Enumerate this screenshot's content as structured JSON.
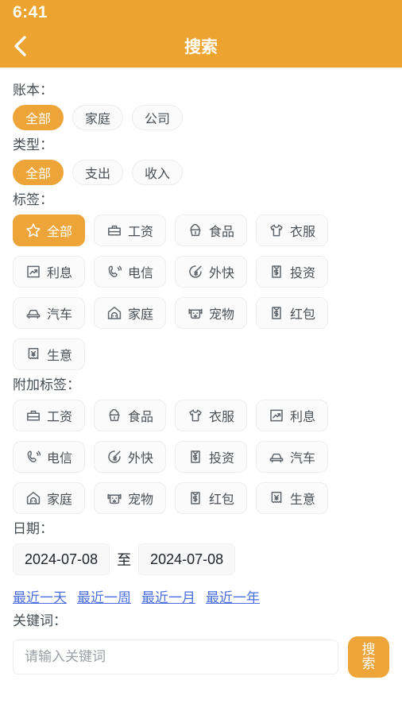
{
  "status": {
    "time": "6:41"
  },
  "header": {
    "title": "搜索",
    "back_icon": "chevron-left-icon",
    "bg": "#eda32f"
  },
  "theme": {
    "accent": "#eda53a",
    "link": "#4b6fe0"
  },
  "sections": {
    "account_book": {
      "label": "账本：",
      "options": [
        {
          "label": "全部",
          "active": true
        },
        {
          "label": "家庭",
          "active": false
        },
        {
          "label": "公司",
          "active": false
        }
      ]
    },
    "type": {
      "label": "类型：",
      "options": [
        {
          "label": "全部",
          "active": true
        },
        {
          "label": "支出",
          "active": false
        },
        {
          "label": "收入",
          "active": false
        }
      ]
    },
    "tags": {
      "label": "标签：",
      "items": [
        {
          "label": "全部",
          "icon": "star-icon",
          "active": true
        },
        {
          "label": "工资",
          "icon": "briefcase-icon",
          "active": false
        },
        {
          "label": "食品",
          "icon": "cupcake-icon",
          "active": false
        },
        {
          "label": "衣服",
          "icon": "tshirt-icon",
          "active": false
        },
        {
          "label": "利息",
          "icon": "trend-up-icon",
          "active": false
        },
        {
          "label": "电信",
          "icon": "phone-signal-icon",
          "active": false
        },
        {
          "label": "外快",
          "icon": "clock-yuan-icon",
          "active": false
        },
        {
          "label": "投资",
          "icon": "money-envelope-icon",
          "active": false
        },
        {
          "label": "汽车",
          "icon": "car-icon",
          "active": false
        },
        {
          "label": "家庭",
          "icon": "house-icon",
          "active": false
        },
        {
          "label": "宠物",
          "icon": "dog-icon",
          "active": false
        },
        {
          "label": "红包",
          "icon": "money-envelope-icon",
          "active": false
        },
        {
          "label": "生意",
          "icon": "receipt-yuan-icon",
          "active": false
        }
      ]
    },
    "extra_tags": {
      "label": "附加标签：",
      "items": [
        {
          "label": "工资",
          "icon": "briefcase-icon",
          "active": false
        },
        {
          "label": "食品",
          "icon": "cupcake-icon",
          "active": false
        },
        {
          "label": "衣服",
          "icon": "tshirt-icon",
          "active": false
        },
        {
          "label": "利息",
          "icon": "trend-up-icon",
          "active": false
        },
        {
          "label": "电信",
          "icon": "phone-signal-icon",
          "active": false
        },
        {
          "label": "外快",
          "icon": "clock-yuan-icon",
          "active": false
        },
        {
          "label": "投资",
          "icon": "money-envelope-icon",
          "active": false
        },
        {
          "label": "汽车",
          "icon": "car-icon",
          "active": false
        },
        {
          "label": "家庭",
          "icon": "house-icon",
          "active": false
        },
        {
          "label": "宠物",
          "icon": "dog-icon",
          "active": false
        },
        {
          "label": "红包",
          "icon": "money-envelope-icon",
          "active": false
        },
        {
          "label": "生意",
          "icon": "receipt-yuan-icon",
          "active": false
        }
      ]
    },
    "date": {
      "label": "日期：",
      "start": "2024-07-08",
      "separator": "至",
      "end": "2024-07-08",
      "quick_links": [
        "最近一天",
        "最近一周",
        "最近一月",
        "最近一年"
      ]
    },
    "keyword": {
      "label": "关键词：",
      "value": "",
      "placeholder": "请输入关键词",
      "search_button": "搜索"
    }
  }
}
